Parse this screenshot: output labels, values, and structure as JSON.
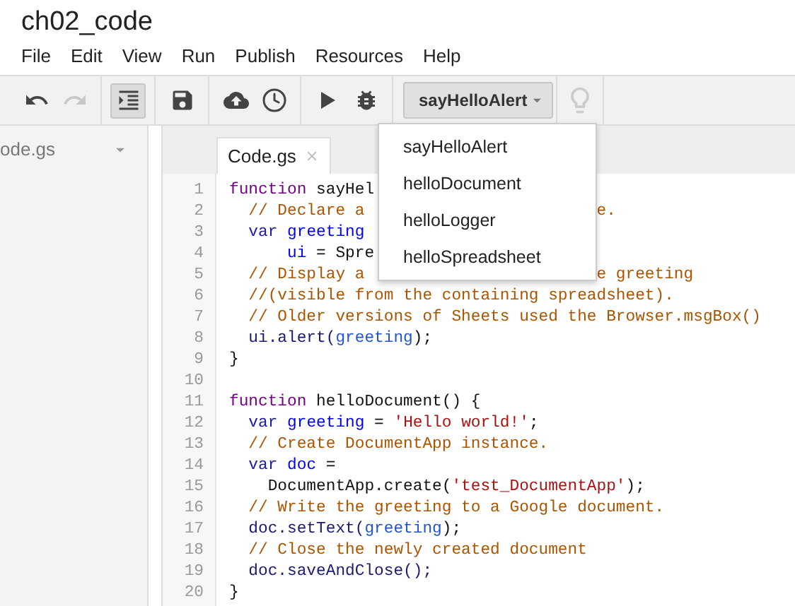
{
  "document_title": "ch02_code",
  "menu": [
    "File",
    "Edit",
    "View",
    "Run",
    "Publish",
    "Resources",
    "Help"
  ],
  "toolbar": [
    {
      "kind": "undo",
      "disabled": false,
      "pressed": false
    },
    {
      "kind": "redo",
      "disabled": true,
      "pressed": false
    },
    {
      "kind": "indent",
      "disabled": false,
      "pressed": true
    },
    {
      "kind": "save",
      "disabled": false,
      "pressed": false
    },
    {
      "kind": "publish",
      "disabled": false,
      "pressed": false
    },
    {
      "kind": "triggers",
      "disabled": false,
      "pressed": false
    },
    {
      "kind": "run",
      "disabled": false,
      "pressed": false
    },
    {
      "kind": "debug",
      "disabled": false,
      "pressed": false
    }
  ],
  "function_select": {
    "value": "sayHelloAlert",
    "expanded": true
  },
  "hint_button": {
    "disabled": true
  },
  "file_list": {
    "value": "ode.gs"
  },
  "tabs": [
    {
      "label": "Code.gs",
      "selected": true
    }
  ],
  "function_menu": [
    {
      "label": "sayHelloAlert"
    },
    {
      "label": "helloDocument"
    },
    {
      "label": "helloLogger"
    },
    {
      "label": "helloSpreadsheet"
    }
  ],
  "code_lines": [
    {
      "number": "1",
      "segments": [
        {
          "kind": "keyword",
          "text": "function"
        },
        {
          "kind": "plain",
          "text": " sayHel"
        }
      ]
    },
    {
      "number": "2",
      "segments": [
        {
          "kind": "comment",
          "text": "  // Declare a"
        }
      ],
      "tail": [
        {
          "kind": "comment",
          "text": "e."
        }
      ]
    },
    {
      "number": "3",
      "segments": [
        {
          "kind": "var",
          "text": "  var"
        },
        {
          "kind": "def",
          "text": " greeting"
        }
      ]
    },
    {
      "number": "4",
      "segments": [
        {
          "kind": "def",
          "text": "      ui"
        },
        {
          "kind": "plain",
          "text": " = Spre"
        }
      ]
    },
    {
      "number": "5",
      "segments": [
        {
          "kind": "comment",
          "text": "  // Display a"
        }
      ],
      "tail": [
        {
          "kind": "comment",
          "text": "e greeting"
        }
      ]
    },
    {
      "number": "6",
      "segments": [
        {
          "kind": "comment",
          "text": "  //(visible from the containing spreadsheet)."
        }
      ]
    },
    {
      "number": "7",
      "segments": [
        {
          "kind": "comment",
          "text": "  // Older versions of Sheets used the Browser.msgBox()"
        }
      ]
    },
    {
      "number": "8",
      "segments": [
        {
          "kind": "call",
          "text": "  ui.alert("
        },
        {
          "kind": "variable",
          "text": "greeting"
        },
        {
          "kind": "plain",
          "text": ");"
        }
      ]
    },
    {
      "number": "9",
      "segments": [
        {
          "kind": "plain",
          "text": "}"
        }
      ]
    },
    {
      "number": "10"
    },
    {
      "number": "11",
      "segments": [
        {
          "kind": "keyword",
          "text": "function"
        },
        {
          "kind": "plain",
          "text": " helloDocument() {"
        }
      ]
    },
    {
      "number": "12",
      "segments": [
        {
          "kind": "var",
          "text": "  var"
        },
        {
          "kind": "def",
          "text": " greeting"
        },
        {
          "kind": "plain",
          "text": " = "
        },
        {
          "kind": "string",
          "text": "'Hello world!'"
        },
        {
          "kind": "plain",
          "text": ";"
        }
      ]
    },
    {
      "number": "13",
      "segments": [
        {
          "kind": "comment",
          "text": "  // Create DocumentApp instance."
        }
      ]
    },
    {
      "number": "14",
      "segments": [
        {
          "kind": "var",
          "text": "  var"
        },
        {
          "kind": "def",
          "text": " doc"
        },
        {
          "kind": "plain",
          "text": " ="
        }
      ]
    },
    {
      "number": "15",
      "segments": [
        {
          "kind": "plain",
          "text": "    DocumentApp.create("
        },
        {
          "kind": "string",
          "text": "'test_DocumentApp'"
        },
        {
          "kind": "plain",
          "text": ");"
        }
      ]
    },
    {
      "number": "16",
      "segments": [
        {
          "kind": "comment",
          "text": "  // Write the greeting to a Google document."
        }
      ]
    },
    {
      "number": "17",
      "segments": [
        {
          "kind": "call",
          "text": "  doc.setText("
        },
        {
          "kind": "variable",
          "text": "greeting"
        },
        {
          "kind": "plain",
          "text": ");"
        }
      ]
    },
    {
      "number": "18",
      "segments": [
        {
          "kind": "comment",
          "text": "  // Close the newly created document"
        }
      ]
    },
    {
      "number": "19",
      "segments": [
        {
          "kind": "call",
          "text": "  doc.saveAndClose();"
        }
      ]
    },
    {
      "number": "20",
      "segments": [
        {
          "kind": "plain",
          "text": "}"
        }
      ]
    }
  ]
}
